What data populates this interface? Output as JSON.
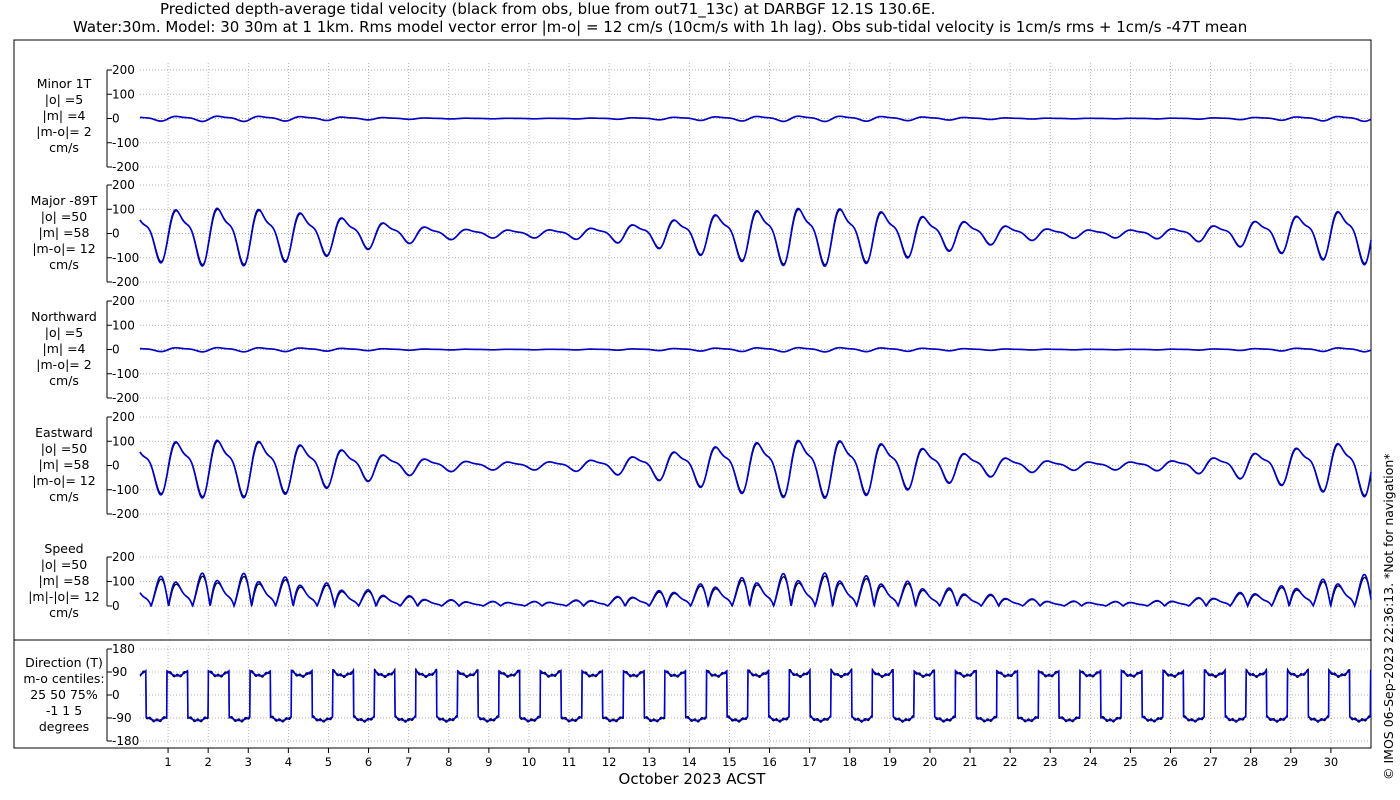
{
  "title_line1": "Predicted depth-average tidal velocity (black from obs, blue from out71_13c) at DARBGF 12.1S 130.6E.",
  "title_line2": "Water:30m. Model: 30 30m at 1 1km. Rms model vector error |m-o| = 12 cm/s (10cm/s with 1h lag). Obs sub-tidal velocity is 1cm/s rms + 1cm/s -47T mean",
  "copyright": "© IMOS 06-Sep-2023 22:36:13. *Not for navigation*",
  "colors": {
    "obs": "#000000",
    "model": "#0000cc",
    "grid": "#999999"
  },
  "chart_data": {
    "type": "line",
    "xlabel": "October 2023 ACST",
    "x_ticks": [
      "1",
      "2",
      "3",
      "4",
      "5",
      "6",
      "7",
      "8",
      "9",
      "10",
      "11",
      "12",
      "13",
      "14",
      "15",
      "16",
      "17",
      "18",
      "19",
      "20",
      "21",
      "22",
      "23",
      "24",
      "25",
      "26",
      "27",
      "28",
      "29",
      "30"
    ],
    "x_range_days": [
      0.3,
      31.0
    ],
    "series": [
      {
        "name": "obs"
      },
      {
        "name": "model"
      }
    ],
    "panels": [
      {
        "key": "minor",
        "labels": [
          "Minor 1T",
          "|o| =5",
          "|m| =4",
          "|m-o|= 2",
          "cm/s"
        ],
        "yticks": [
          "200",
          "100",
          "0",
          "-100",
          "-200"
        ],
        "ylim": [
          -200,
          200
        ],
        "amplitude": {
          "spring": 10,
          "neap": 1
        }
      },
      {
        "key": "major",
        "labels": [
          "Major -89T",
          "|o| =50",
          "|m| =58",
          "|m-o|= 12",
          "cm/s"
        ],
        "yticks": [
          "200",
          "100",
          "0",
          "-100",
          "-200"
        ],
        "ylim": [
          -200,
          200
        ],
        "amplitude": {
          "spring": 110,
          "neap": 15
        }
      },
      {
        "key": "northward",
        "labels": [
          "Northward",
          "|o| =5",
          "|m| =4",
          "|m-o|= 2",
          "cm/s"
        ],
        "yticks": [
          "200",
          "100",
          "0",
          "-100",
          "-200"
        ],
        "ylim": [
          -200,
          200
        ],
        "amplitude": {
          "spring": 8,
          "neap": 1
        }
      },
      {
        "key": "eastward",
        "labels": [
          "Eastward",
          "|o| =50",
          "|m| =58",
          "|m-o|= 12",
          "cm/s"
        ],
        "yticks": [
          "200",
          "100",
          "0",
          "-100",
          "-200"
        ],
        "ylim": [
          -200,
          200
        ],
        "amplitude": {
          "spring": 110,
          "neap": 15
        }
      },
      {
        "key": "speed",
        "labels": [
          "Speed",
          "|o| =50",
          "|m| =58",
          "|m|-|o|= 12",
          "cm/s"
        ],
        "yticks": [
          "200",
          "100",
          "0"
        ],
        "ylim": [
          0,
          200
        ],
        "amplitude": {
          "spring": 110,
          "neap": 15
        }
      },
      {
        "key": "direction",
        "labels": [
          "Direction (T)",
          "m-o centiles:",
          "25  50  75%",
          "-1  1  5",
          "degrees"
        ],
        "yticks": [
          "180",
          "90",
          "0",
          "-90",
          "-180"
        ],
        "ylim": [
          -180,
          180
        ],
        "direction_levels": [
          90,
          -90
        ]
      }
    ]
  }
}
